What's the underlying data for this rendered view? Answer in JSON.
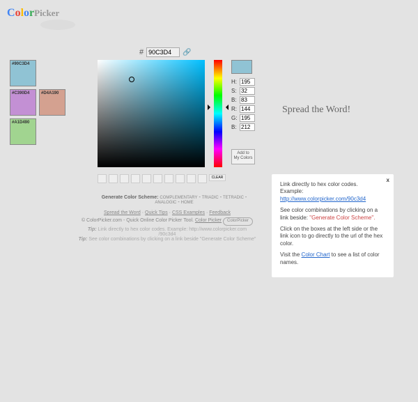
{
  "logo": {
    "text": "ColorPicker"
  },
  "hex": {
    "prefix": "#",
    "value": "90C3D4"
  },
  "swatches": [
    {
      "hex": "#90C3D4",
      "color": "#90C3D4"
    },
    {
      "hex": "#C390D4",
      "color": "#C390D4"
    },
    {
      "hex": "#D4A190",
      "color": "#D4A190"
    },
    {
      "hex": "#A1D490",
      "color": "#A1D490"
    }
  ],
  "preview_color": "#90C3D4",
  "channels": {
    "H": "195",
    "S": "32",
    "B": "83",
    "R": "144",
    "G": "195",
    "B2": "212"
  },
  "labels": {
    "H": "H:",
    "S": "S:",
    "Br": "B:",
    "R": "R:",
    "G": "G:",
    "Bl": "B:"
  },
  "add_btn": {
    "l1": "Add to",
    "l2": "My Colors"
  },
  "clear_label": "CLEAR",
  "scheme": {
    "title": "Generate Color Scheme:",
    "links": [
      "COMPLEMENTARY",
      "TRIADIC",
      "TETRADIC",
      "ANALOGIC",
      "HOME"
    ]
  },
  "footer": {
    "links": [
      "Spread the Word",
      "Quick Tips",
      "CSS Examples",
      "Feedback"
    ],
    "copyright": "© ColorPicker.com - Quick Online Color Picker Tool.",
    "cp_link": "Color Picker",
    "cp_btn": "ColorPicker"
  },
  "tips": {
    "label": "Tip:",
    "t1a": "Link directly to hex color codes.   Example:   http://www.colorpicker.com",
    "t1b": "/90c3d4",
    "t2": "See color combinations by clicking on a link beside",
    "t2q": "\"Generate Color Scheme\""
  },
  "spread": "Spread the Word!",
  "info": {
    "close": "x",
    "p1": "Link directly to hex color codes.",
    "p1ex": "Example: ",
    "p1url": "http://www.colorpicker.com/90c3d4",
    "p2a": "See color combinations by clicking on a link beside: ",
    "p2b": "\"Generate Color Scheme\".",
    "p3": "Click on the boxes at the left side or the link icon to go directly to the url of the hex color.",
    "p4a": "Visit the ",
    "p4link": "Color Chart",
    "p4b": " to see a list of color names."
  }
}
